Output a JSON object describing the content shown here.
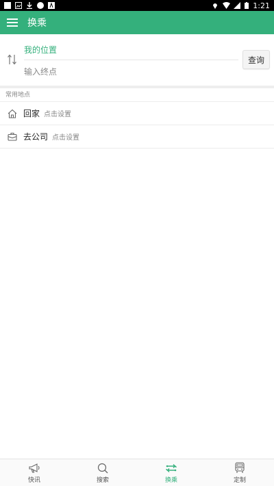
{
  "status_bar": {
    "time": "1:21"
  },
  "app_bar": {
    "title": "换乘"
  },
  "route": {
    "from_label": "我的位置",
    "to_placeholder": "输入终点",
    "query_label": "查询"
  },
  "favorites": {
    "header": "常用地点",
    "items": [
      {
        "name": "回家",
        "hint": "点击设置",
        "icon": "home-icon"
      },
      {
        "name": "去公司",
        "hint": "点击设置",
        "icon": "briefcase-icon"
      }
    ]
  },
  "bottom_nav": {
    "active_index": 2,
    "accent": "#34b07c",
    "items": [
      {
        "label": "快讯",
        "icon": "megaphone-icon"
      },
      {
        "label": "搜索",
        "icon": "search-icon"
      },
      {
        "label": "换乘",
        "icon": "transfer-icon"
      },
      {
        "label": "定制",
        "icon": "bus-icon"
      }
    ]
  }
}
